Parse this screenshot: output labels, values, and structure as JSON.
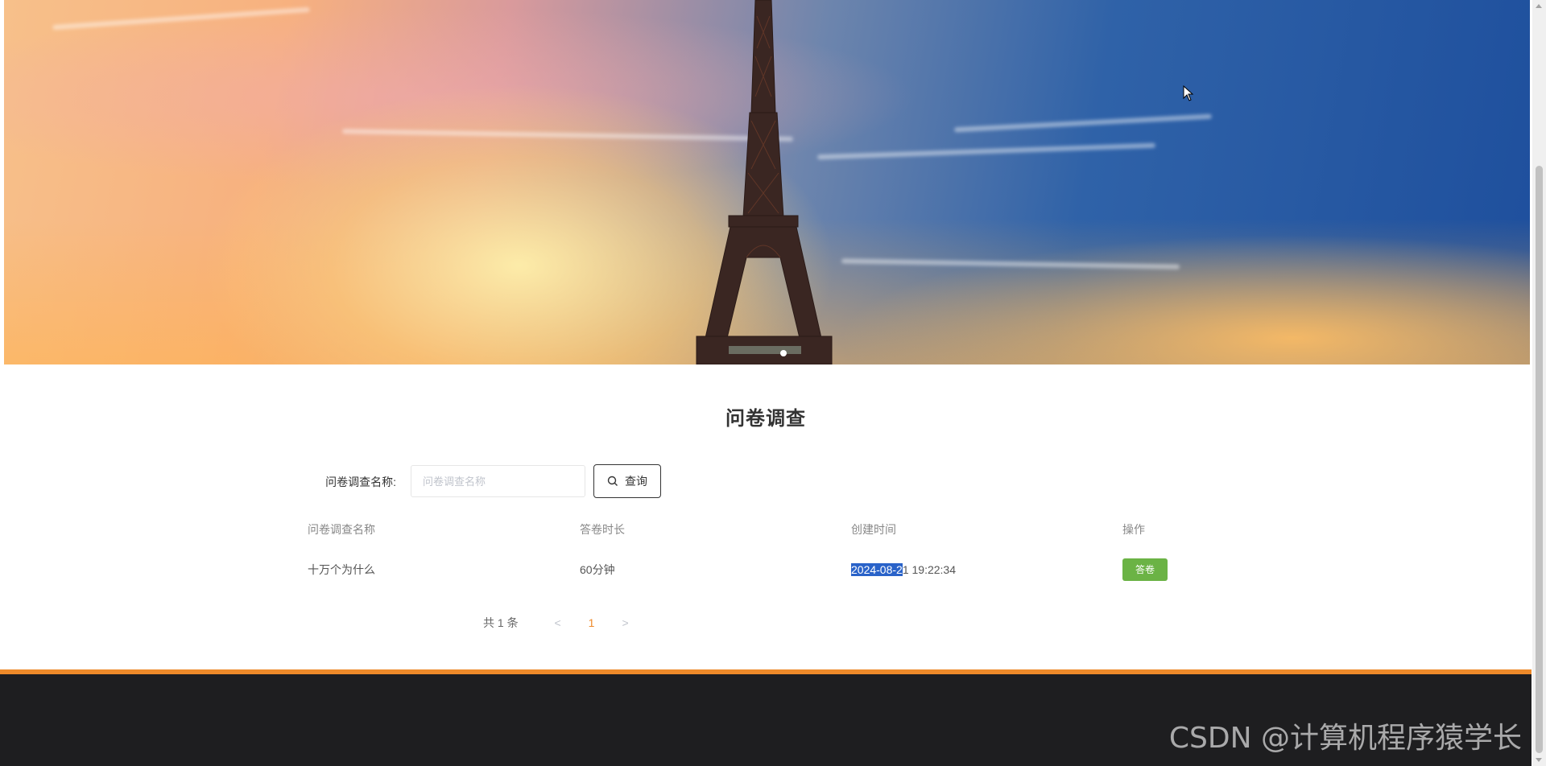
{
  "banner": {
    "active_slide": 1,
    "slide_count": 1
  },
  "page": {
    "title": "问卷调查"
  },
  "search": {
    "label": "问卷调查名称:",
    "placeholder": "问卷调查名称",
    "value": "",
    "button_label": "查询"
  },
  "table": {
    "headers": [
      "问卷调查名称",
      "答卷时长",
      "创建时间",
      "操作"
    ],
    "rows": [
      {
        "name": "十万个为什么",
        "duration": "60分钟",
        "created_date": "2024-08-2",
        "created_rest": "1 19:22:34",
        "action": "答卷"
      }
    ]
  },
  "pagination": {
    "total": "共 1 条",
    "prev": "<",
    "current": "1",
    "next": ">"
  },
  "footer": {
    "watermark": "CSDN @计算机程序猿学长"
  },
  "colors": {
    "accent": "#ee8a2a",
    "action_button": "#6bb345",
    "footer_bg": "#1e1e20",
    "selection": "#2a63c9"
  }
}
